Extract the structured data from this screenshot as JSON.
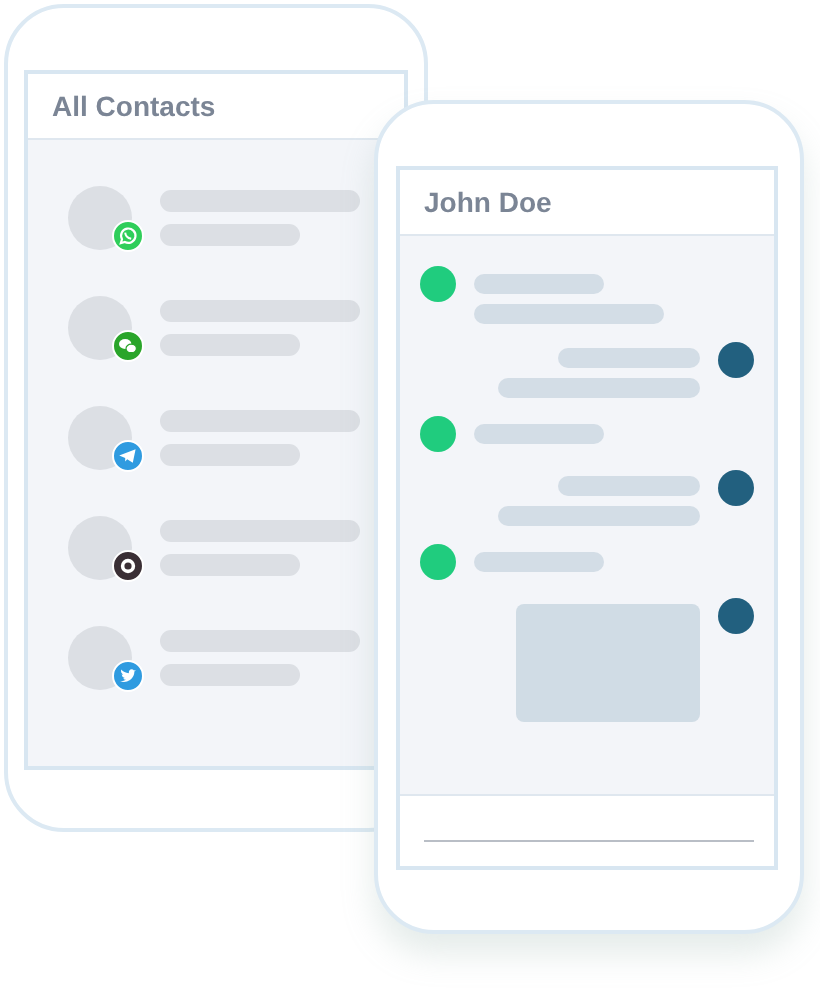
{
  "contacts_phone": {
    "title": "All Contacts",
    "contacts": [
      {
        "kind": "whatsapp"
      },
      {
        "kind": "wechat"
      },
      {
        "kind": "telegram"
      },
      {
        "kind": "camera"
      },
      {
        "kind": "twitter"
      }
    ]
  },
  "chat_phone": {
    "title": "John Doe",
    "messages": [
      {
        "outgoing": false,
        "kind": "two-line"
      },
      {
        "outgoing": true,
        "kind": "two-line"
      },
      {
        "outgoing": false,
        "kind": "one-line"
      },
      {
        "outgoing": true,
        "kind": "two-line"
      },
      {
        "outgoing": false,
        "kind": "one-line"
      },
      {
        "outgoing": true,
        "kind": "image"
      }
    ]
  }
}
